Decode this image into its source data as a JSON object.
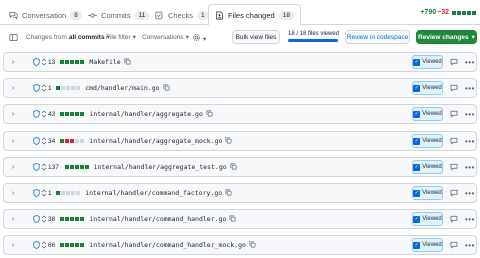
{
  "tabs": [
    {
      "label": "Conversation",
      "count": "8",
      "icon": "comment-discussion-icon"
    },
    {
      "label": "Commits",
      "count": "11",
      "icon": "commit-icon"
    },
    {
      "label": "Checks",
      "count": "1",
      "icon": "checklist-icon"
    },
    {
      "label": "Files changed",
      "count": "18",
      "icon": "file-diff-icon",
      "active": true
    }
  ],
  "diffstat": {
    "additions": "+790",
    "deletions": "−32"
  },
  "toolbar": {
    "changes_from_prefix": "Changes from",
    "changes_from_value": "all commits",
    "file_filter": "File filter",
    "conversations": "Conversations",
    "bulk_view": "Bulk view files",
    "files_viewed": "18 / 18 files viewed",
    "files_viewed_fraction": 1.0,
    "review_codespace": "Review in codespace",
    "review_changes": "Review changes"
  },
  "colors": {
    "add": "#1a7f37",
    "delete": "#d1242f",
    "neutral": "#d0d7de",
    "accent": "#0969da",
    "primary_button": "#1f883d"
  },
  "viewed_label": "Viewed",
  "files": [
    {
      "count": "13",
      "name": "Makefile",
      "bar": [
        "a",
        "a",
        "a",
        "a",
        "a"
      ]
    },
    {
      "count": "1",
      "name": "cmd/handler/main.go",
      "bar": [
        "a",
        "n",
        "n",
        "n",
        "n"
      ]
    },
    {
      "count": "43",
      "name": "internal/handler/aggregate.go",
      "bar": [
        "a",
        "a",
        "a",
        "a",
        "a"
      ]
    },
    {
      "count": "34",
      "name": "internal/handler/aggregate_mock.go",
      "bar": [
        "a",
        "d",
        "d",
        "n",
        "n"
      ]
    },
    {
      "count": "137",
      "name": "internal/handler/aggregate_test.go",
      "bar": [
        "a",
        "a",
        "a",
        "a",
        "a"
      ]
    },
    {
      "count": "1",
      "name": "internal/handler/command_factory.go",
      "bar": [
        "a",
        "n",
        "n",
        "n",
        "n"
      ]
    },
    {
      "count": "38",
      "name": "internal/handler/command_handler.go",
      "bar": [
        "a",
        "a",
        "a",
        "a",
        "a"
      ]
    },
    {
      "count": "66",
      "name": "internal/handler/command_handler_mock.go",
      "bar": [
        "a",
        "a",
        "a",
        "a",
        "a"
      ]
    }
  ]
}
